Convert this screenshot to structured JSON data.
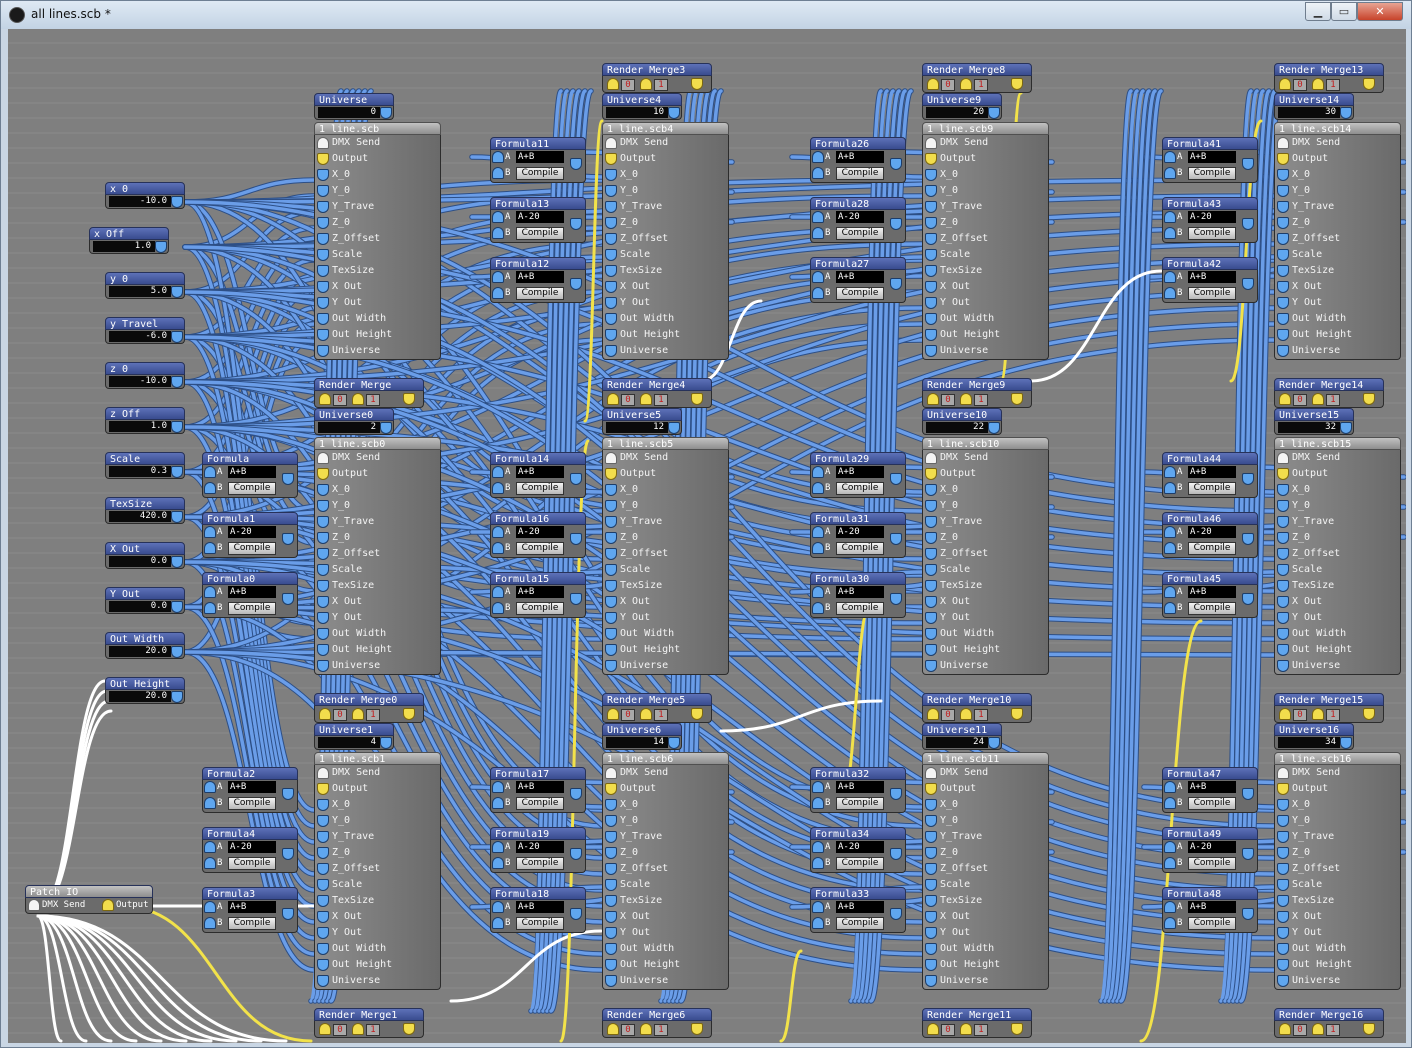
{
  "window": {
    "title": "all lines.scb *",
    "min_label": "▁",
    "max_label": "▭",
    "close_label": "✕"
  },
  "colors": {
    "canvas": "#7f7f7f",
    "wire_blue": "#6a9de8",
    "wire_yellow": "#f2e24a",
    "wire_white": "#ffffff",
    "node_header": "#4558a0"
  },
  "value_nodes": [
    {
      "name": "x_0",
      "value": "-10.0"
    },
    {
      "name": "x_Off",
      "value": "1.0"
    },
    {
      "name": "y_0",
      "value": "5.0"
    },
    {
      "name": "y_Travel",
      "value": "-6.0"
    },
    {
      "name": "z_0",
      "value": "-10.0"
    },
    {
      "name": "z_Off",
      "value": "1.0"
    },
    {
      "name": "Scale",
      "value": "0.3"
    },
    {
      "name": "TexSize",
      "value": "420.0"
    },
    {
      "name": "X_Out",
      "value": "0.0"
    },
    {
      "name": "Y_Out",
      "value": "0.0"
    },
    {
      "name": "Out_Width",
      "value": "20.0"
    },
    {
      "name": "Out_Height",
      "value": "20.0"
    }
  ],
  "patch_io": {
    "title": "Patch IO",
    "in_label": "DMX Send",
    "out_label": "Output"
  },
  "universes": [
    {
      "name": "Universe",
      "value": "0"
    },
    {
      "name": "Universe4",
      "value": "10"
    },
    {
      "name": "Universe9",
      "value": "20"
    },
    {
      "name": "Universe14",
      "value": "30"
    },
    {
      "name": "Universe0",
      "value": "2"
    },
    {
      "name": "Universe5",
      "value": "12"
    },
    {
      "name": "Universe10",
      "value": "22"
    },
    {
      "name": "Universe15",
      "value": "32"
    },
    {
      "name": "Universe1",
      "value": "4"
    },
    {
      "name": "Universe6",
      "value": "14"
    },
    {
      "name": "Universe11",
      "value": "24"
    },
    {
      "name": "Universe16",
      "value": "34"
    }
  ],
  "render_merges": [
    {
      "name": "Render Merge3",
      "a": "0",
      "b": "1"
    },
    {
      "name": "Render Merge8",
      "a": "0",
      "b": "1"
    },
    {
      "name": "Render Merge13",
      "a": "0",
      "b": "1"
    },
    {
      "name": "Render Merge",
      "a": "0",
      "b": "1"
    },
    {
      "name": "Render Merge4",
      "a": "0",
      "b": "1"
    },
    {
      "name": "Render Merge9",
      "a": "0",
      "b": "1"
    },
    {
      "name": "Render Merge14",
      "a": "0",
      "b": "1"
    },
    {
      "name": "Render Merge0",
      "a": "0",
      "b": "1"
    },
    {
      "name": "Render Merge5",
      "a": "0",
      "b": "1"
    },
    {
      "name": "Render Merge10",
      "a": "0",
      "b": "1"
    },
    {
      "name": "Render Merge15",
      "a": "0",
      "b": "1"
    },
    {
      "name": "Render Merge1",
      "a": "0",
      "b": "1"
    },
    {
      "name": "Render Merge6",
      "a": "0",
      "b": "1"
    },
    {
      "name": "Render Merge11",
      "a": "0",
      "b": "1"
    },
    {
      "name": "Render Merge16",
      "a": "0",
      "b": "1"
    }
  ],
  "scb_nodes": [
    {
      "title": "1 line.scb"
    },
    {
      "title": "1 line.scb4"
    },
    {
      "title": "1 line.scb9"
    },
    {
      "title": "1 line.scb14"
    },
    {
      "title": "1 line.scb0"
    },
    {
      "title": "1 line.scb5"
    },
    {
      "title": "1 line.scb10"
    },
    {
      "title": "1 line.scb15"
    },
    {
      "title": "1 line.scb1"
    },
    {
      "title": "1 line.scb6"
    },
    {
      "title": "1 line.scb11"
    },
    {
      "title": "1 line.scb16"
    }
  ],
  "scb_ports": [
    "DMX Send",
    "Output",
    "X_0",
    "Y_0",
    "Y_Trave",
    "Z_0",
    "Z_Offset",
    "Scale",
    "TexSize",
    "X Out",
    "Y Out",
    "Out Width",
    "Out Height",
    "Universe"
  ],
  "formulas": [
    {
      "name": "Formula11",
      "expr": "A+B"
    },
    {
      "name": "Formula13",
      "expr": "A-20"
    },
    {
      "name": "Formula12",
      "expr": "A+B"
    },
    {
      "name": "Formula26",
      "expr": "A+B"
    },
    {
      "name": "Formula28",
      "expr": "A-20"
    },
    {
      "name": "Formula27",
      "expr": "A+B"
    },
    {
      "name": "Formula41",
      "expr": "A+B"
    },
    {
      "name": "Formula43",
      "expr": "A-20"
    },
    {
      "name": "Formula42",
      "expr": "A+B"
    },
    {
      "name": "Formula",
      "expr": "A+B"
    },
    {
      "name": "Formula1",
      "expr": "A-20"
    },
    {
      "name": "Formula0",
      "expr": "A+B"
    },
    {
      "name": "Formula14",
      "expr": "A+B"
    },
    {
      "name": "Formula16",
      "expr": "A-20"
    },
    {
      "name": "Formula15",
      "expr": "A+B"
    },
    {
      "name": "Formula29",
      "expr": "A+B"
    },
    {
      "name": "Formula31",
      "expr": "A-20"
    },
    {
      "name": "Formula30",
      "expr": "A+B"
    },
    {
      "name": "Formula44",
      "expr": "A+B"
    },
    {
      "name": "Formula46",
      "expr": "A-20"
    },
    {
      "name": "Formula45",
      "expr": "A+B"
    },
    {
      "name": "Formula2",
      "expr": "A+B"
    },
    {
      "name": "Formula4",
      "expr": "A-20"
    },
    {
      "name": "Formula3",
      "expr": "A+B"
    },
    {
      "name": "Formula17",
      "expr": "A+B"
    },
    {
      "name": "Formula19",
      "expr": "A-20"
    },
    {
      "name": "Formula18",
      "expr": "A+B"
    },
    {
      "name": "Formula32",
      "expr": "A+B"
    },
    {
      "name": "Formula34",
      "expr": "A-20"
    },
    {
      "name": "Formula33",
      "expr": "A+B"
    },
    {
      "name": "Formula47",
      "expr": "A+B"
    },
    {
      "name": "Formula49",
      "expr": "A-20"
    },
    {
      "name": "Formula48",
      "expr": "A+B"
    }
  ],
  "formula_labels": {
    "a": "A",
    "b": "B",
    "compile": "Compile"
  }
}
